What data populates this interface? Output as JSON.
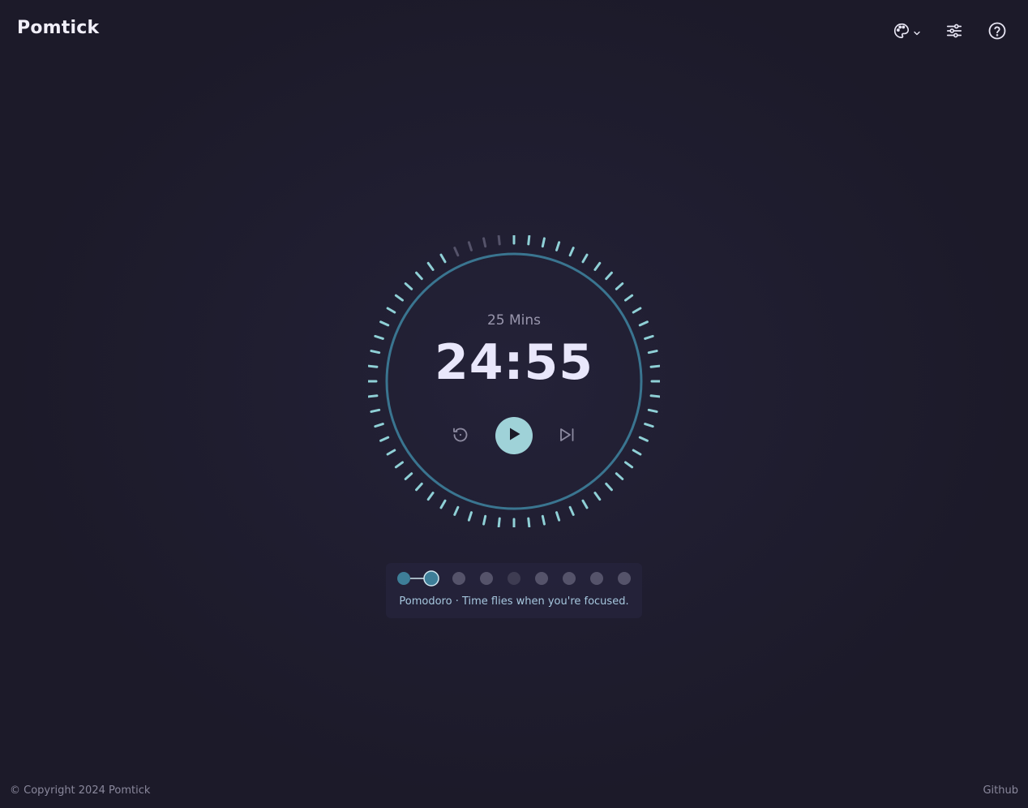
{
  "app": {
    "title": "Pomtick"
  },
  "header": {
    "icons": [
      "palette-icon",
      "chevron-down-icon",
      "sliders-icon",
      "help-icon"
    ]
  },
  "timer": {
    "mins_label": "25 Mins",
    "time": "24:55",
    "total_ticks": 60,
    "elapsed_ticks": 4,
    "controls": [
      "reset-icon",
      "play-icon",
      "skip-icon"
    ]
  },
  "session": {
    "total_steps": 9,
    "completed_steps": 1,
    "current_step": 2,
    "caption": "Pomodoro · Time flies when you're focused."
  },
  "footer": {
    "copyright": "© Copyright 2024 Pomtick",
    "link": "Github"
  },
  "colors": {
    "accent": "#9fd2d8",
    "ring": "#3a7590",
    "tick_active": "#8fd0d6",
    "tick_elapsed": "#55536a",
    "dot_done": "#3e7e98",
    "dot_pending": "#55536a",
    "dot_break": "#3e3c52"
  }
}
